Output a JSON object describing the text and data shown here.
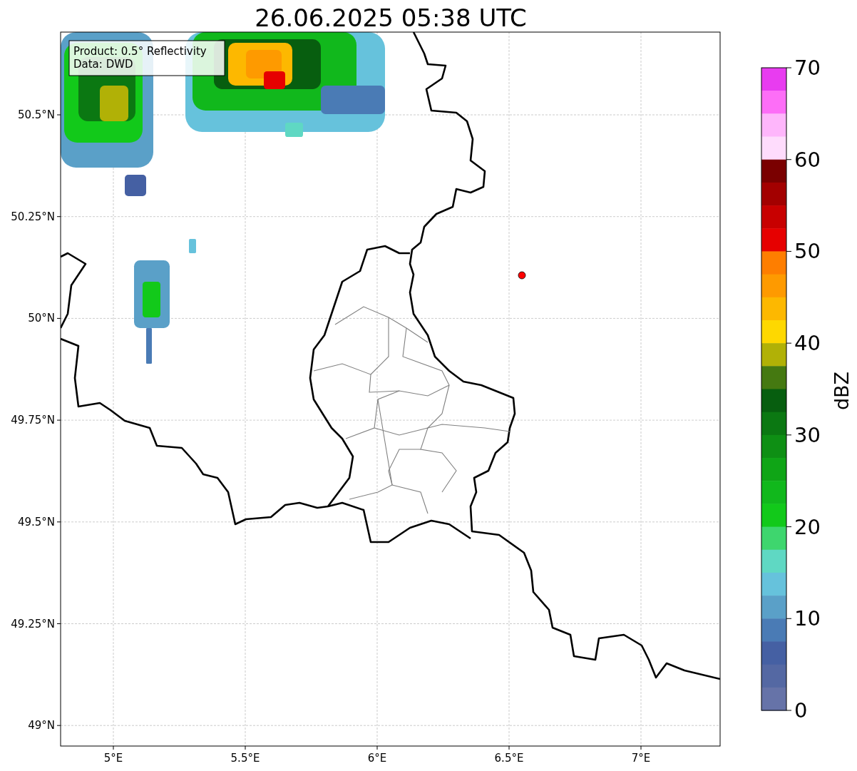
{
  "title": "26.06.2025 05:38 UTC",
  "info_box": [
    "Product: 0.5° Reflectivity",
    "Data: DWD"
  ],
  "x_ticks": [
    "5°E",
    "5.5°E",
    "6°E",
    "6.5°E",
    "7°E"
  ],
  "y_ticks": [
    "50.5°N",
    "50.25°N",
    "50°N",
    "49.75°N",
    "49.5°N",
    "49.25°N",
    "49°N"
  ],
  "radar_site": {
    "color": "#ff0000"
  },
  "colorbar": {
    "label": "dBZ",
    "ticks": [
      "70",
      "60",
      "50",
      "40",
      "30",
      "20",
      "10",
      "0"
    ],
    "bins": [
      {
        "color": "#e83cf0"
      },
      {
        "color": "#fd6ef7"
      },
      {
        "color": "#feb6fb"
      },
      {
        "color": "#fedcfc"
      },
      {
        "color": "#7a0000"
      },
      {
        "color": "#a30000"
      },
      {
        "color": "#c80000"
      },
      {
        "color": "#e60000"
      },
      {
        "color": "#fe7e00"
      },
      {
        "color": "#fe9a00"
      },
      {
        "color": "#fdb800"
      },
      {
        "color": "#fed800"
      },
      {
        "color": "#b1b106"
      },
      {
        "color": "#457911"
      },
      {
        "color": "#075e0f"
      },
      {
        "color": "#0b7812"
      },
      {
        "color": "#0e8f14"
      },
      {
        "color": "#0fa516"
      },
      {
        "color": "#11b81c"
      },
      {
        "color": "#12c91a"
      },
      {
        "color": "#3ed66e"
      },
      {
        "color": "#5fd8c3"
      },
      {
        "color": "#66c2dc"
      },
      {
        "color": "#5aa0c8"
      },
      {
        "color": "#4a7bb5"
      },
      {
        "color": "#4560a3"
      },
      {
        "color": "#5468a3"
      },
      {
        "color": "#6673a8"
      }
    ]
  }
}
